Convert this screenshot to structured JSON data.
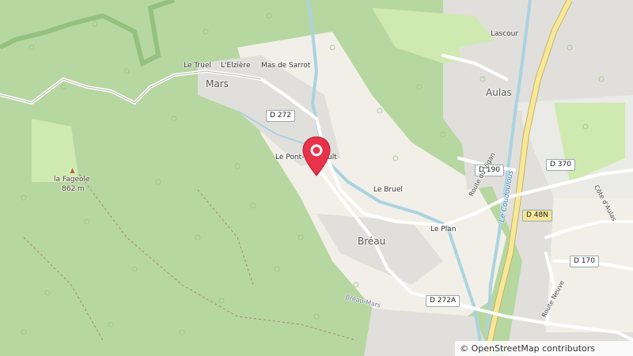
{
  "map": {
    "places": {
      "le_truel": "Le Truel",
      "lelziere": "L'Elzière",
      "mas_de_sarrot": "Mas de Sarrot",
      "mars": "Mars",
      "lascour": "Lascour",
      "aulas": "Aulas",
      "le_pont": "Le Pont-d'Hérault",
      "le_bruel": "Le Bruel",
      "le_plan": "Le Plan",
      "breau": "Bréau",
      "peak_name": "la Fageole",
      "peak_elevation": "862 m"
    },
    "roads": {
      "d272": "D 272",
      "d190": "D 190",
      "d370": "D 370",
      "d48n": "D 48N",
      "d170": "D 170",
      "d272a": "D 272A",
      "route_du_vigan": "Route du Vigan",
      "cote_daulas": "Côte d'Aulas",
      "route_neuve": "Route Neuve",
      "breau_mars": "Bréau-Mars"
    },
    "waterways": {
      "coudoulous": "Le Coudoulous"
    },
    "attribution": "© OpenStreetMap contributors",
    "colors": {
      "forest": "#b7d7a0",
      "meadow": "#cfeab0",
      "urban": "#e0dfdc",
      "field": "#f2efe9",
      "road_yellow": "#f6e79a",
      "water": "#aad3df",
      "boundary": "#7fb26a",
      "marker": "#e8334a"
    }
  }
}
